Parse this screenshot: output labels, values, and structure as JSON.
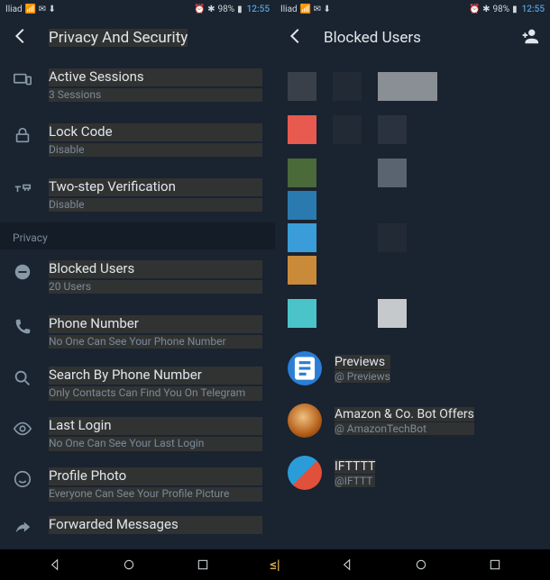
{
  "status": {
    "carrier": "Iliad",
    "signal_icons": "📶",
    "battery": "98%",
    "time": "12:55"
  },
  "left": {
    "title": "Privacy And Security",
    "items": {
      "sessions": {
        "title": "Active Sessions",
        "sub": "3 Sessions"
      },
      "lock": {
        "title": "Lock Code",
        "sub": "Disable"
      },
      "twostep": {
        "title": "Two-step Verification",
        "sub": "Disable"
      },
      "section": "Privacy",
      "blocked": {
        "title": "Blocked Users",
        "sub": "20 Users"
      },
      "phone": {
        "title": "Phone Number",
        "sub": "No One Can See Your Phone Number"
      },
      "search": {
        "title": "Search By Phone Number",
        "sub": "Only Contacts Can Find You On Telegram"
      },
      "lastlogin": {
        "title": "Last Login",
        "sub": "No One Can See Your Last Login"
      },
      "photo": {
        "title": "Profile Photo",
        "sub": "Everyone Can See Your Profile Picture"
      },
      "forward": {
        "title": "Forwarded Messages"
      }
    }
  },
  "right": {
    "title": "Blocked Users",
    "tiles": {
      "row1": [
        "#3a4049",
        "#222a36",
        "#8a8f96"
      ],
      "row2": [
        "#e85a4f",
        "#222a36",
        "#2a3240"
      ],
      "row3": [
        "#4a6a3a",
        "#5a6470"
      ],
      "row4": [
        "#2a7ab0"
      ],
      "row5": [
        "#3a9dd9",
        "#222a36"
      ],
      "row6": [
        "#c98a3a"
      ],
      "row7": [
        "#4ac4c9",
        "#c5c9cc"
      ]
    },
    "users": {
      "u1": {
        "name": "Previews",
        "handle": "@ Previews"
      },
      "u2": {
        "name": "Amazon & Co. Bot Offers",
        "handle": "@ AmazonTechBot"
      },
      "u3": {
        "name": "IFTTTT",
        "handle": "@IFTTT"
      }
    }
  }
}
